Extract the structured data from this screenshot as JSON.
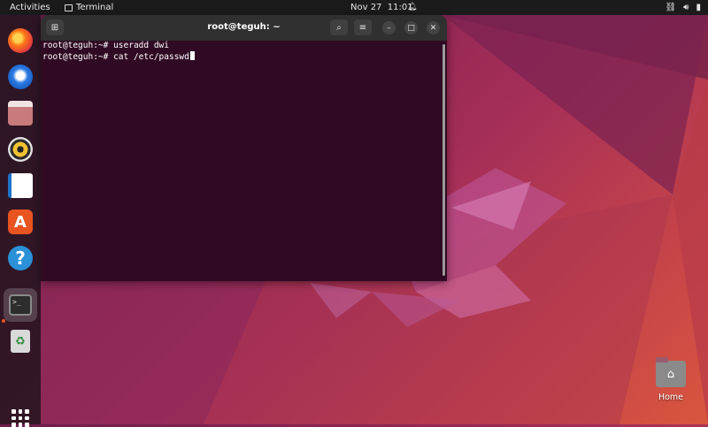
{
  "topbar": {
    "activities": "Activities",
    "app_name": "Terminal",
    "date": "Nov 27",
    "time": "11:01",
    "status_icons": [
      "network-icon",
      "volume-icon",
      "battery-icon"
    ]
  },
  "dock": {
    "apps": [
      {
        "name": "Firefox",
        "icon": "firefox-icon"
      },
      {
        "name": "Thunderbird Mail",
        "icon": "mail-icon"
      },
      {
        "name": "Files",
        "icon": "files-icon"
      },
      {
        "name": "Rhythmbox",
        "icon": "rhythmbox-icon"
      },
      {
        "name": "LibreOffice Writer",
        "icon": "writer-icon"
      },
      {
        "name": "Ubuntu Software",
        "icon": "store-icon"
      },
      {
        "name": "Help",
        "icon": "help-icon"
      },
      {
        "name": "Terminal",
        "icon": "terminal-icon",
        "active": true
      },
      {
        "name": "Trash",
        "icon": "trash-icon"
      }
    ],
    "show_apps_icon": "grid-icon"
  },
  "terminal": {
    "title": "root@teguh: ~",
    "lines": [
      "root@teguh:~# useradd dwi",
      "root@teguh:~# cat /etc/passwd"
    ],
    "colors": {
      "background": "#300a24",
      "header": "#303030",
      "text": "#ffffff"
    }
  },
  "desktop": {
    "home_label": "Home"
  },
  "colors": {
    "accent": "#e95420"
  }
}
